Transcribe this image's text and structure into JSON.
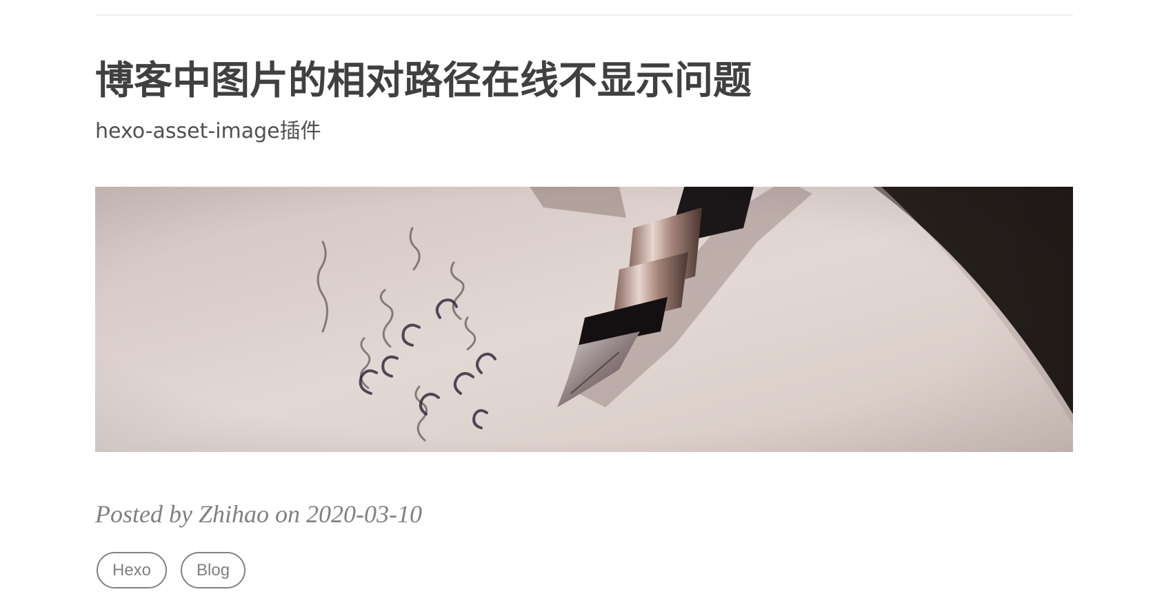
{
  "post": {
    "title": "博客中图片的相对路径在线不显示问题",
    "subtitle": "hexo-asset-image插件",
    "meta": "Posted by Zhihao on 2020-03-10",
    "tags": [
      "Hexo",
      "Blog"
    ]
  },
  "hero_image": {
    "description_icon": "fountain-pen-on-paper-image"
  },
  "colors": {
    "title": "#404040",
    "meta": "#808080",
    "tag_border": "#808080",
    "rule": "#eeeeee"
  }
}
